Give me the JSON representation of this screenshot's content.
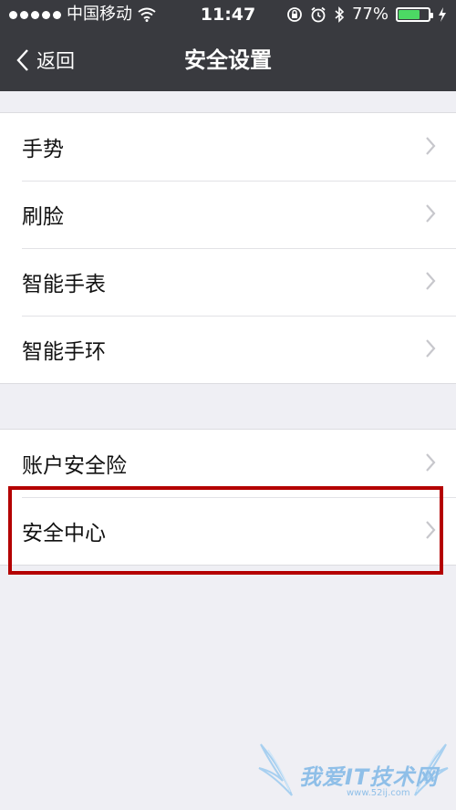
{
  "status_bar": {
    "carrier": "中国移动",
    "time": "11:47",
    "battery_percent": "77%",
    "battery_level": 0.77,
    "icons": [
      "signal-dots-icon",
      "wifi-icon",
      "rotation-lock-icon",
      "alarm-icon",
      "bluetooth-icon",
      "battery-icon",
      "charging-icon"
    ]
  },
  "nav": {
    "back_label": "返回",
    "title": "安全设置"
  },
  "group1": {
    "items": [
      {
        "label": "手势"
      },
      {
        "label": "刷脸"
      },
      {
        "label": "智能手表"
      },
      {
        "label": "智能手环"
      }
    ]
  },
  "group2": {
    "items": [
      {
        "label": "账户安全险"
      },
      {
        "label": "安全中心"
      }
    ]
  },
  "watermark": {
    "text": "我爱IT技术网",
    "url": "www.52ij.com"
  },
  "colors": {
    "nav_bg": "#393a3f",
    "page_bg": "#efeff4",
    "highlight": "#b40000",
    "battery": "#4cd964"
  }
}
